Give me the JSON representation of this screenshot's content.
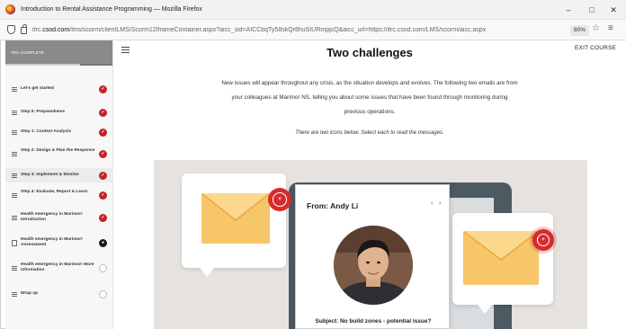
{
  "window": {
    "title": "Introduction to Rental Assistance Programming — Mozilla Firefox",
    "minimize": "–",
    "maximize": "□",
    "close": "✕"
  },
  "urlbar": {
    "url_prefix": "ifrc.",
    "url_domain": "csod.com",
    "url_rest": "/lms/scorm/clientLMS/Scorm12IframeContainer.aspx?aicc_sid=AICCbqTy58skQr8huSIURmpjcQ&aicc_url=https://ifrc.csod.com/LMS/scorm/aicc.aspx",
    "zoom": "80%",
    "star": "☆",
    "menu": "≡"
  },
  "sidebar": {
    "progress_label": "70% COMPLETE",
    "progress_fraction": 0.7,
    "items": [
      {
        "label": "Let's get started",
        "status": "done",
        "icon": "lines"
      },
      {
        "label": "Step 0: Preparedness",
        "status": "done",
        "icon": "lines"
      },
      {
        "label": "Step 1: Context Analysis",
        "status": "done",
        "icon": "lines"
      },
      {
        "label": "Step 2: Design & Plan the Response",
        "status": "done",
        "icon": "lines"
      },
      {
        "label": "Step 3: Implement & Monitor",
        "status": "done",
        "icon": "lines"
      },
      {
        "label": "Step 4: Evaluate, Report & Learn",
        "status": "done",
        "icon": "lines"
      },
      {
        "label": "Health emergency in Marimor! Introduction",
        "status": "done",
        "icon": "lines"
      },
      {
        "label": "Health emergency in Marimor! Assessment",
        "status": "current",
        "icon": "doc"
      },
      {
        "label": "Health emergency in Marimor! More information",
        "status": "empty",
        "icon": "lines"
      },
      {
        "label": "Wrap up",
        "status": "empty",
        "icon": "lines"
      }
    ]
  },
  "main": {
    "exit_label": "EXIT COURSE",
    "heading": "Two challenges",
    "intro": "New issues will appear throughout any crisis, as the situation develops and evolves. The following two emails are from your colleagues at Marimor NS, telling you about some issues that have been found through monitoring during previous operations.",
    "hint": "There are two icons below. Select each to read the messages.",
    "message": {
      "from": "From: Andy Li",
      "nav": "‹ ›",
      "subject": "Subject: No build zones - potential issue?"
    },
    "colors": {
      "accent_red": "#c8202a",
      "envelope": "#f7c66a"
    }
  }
}
